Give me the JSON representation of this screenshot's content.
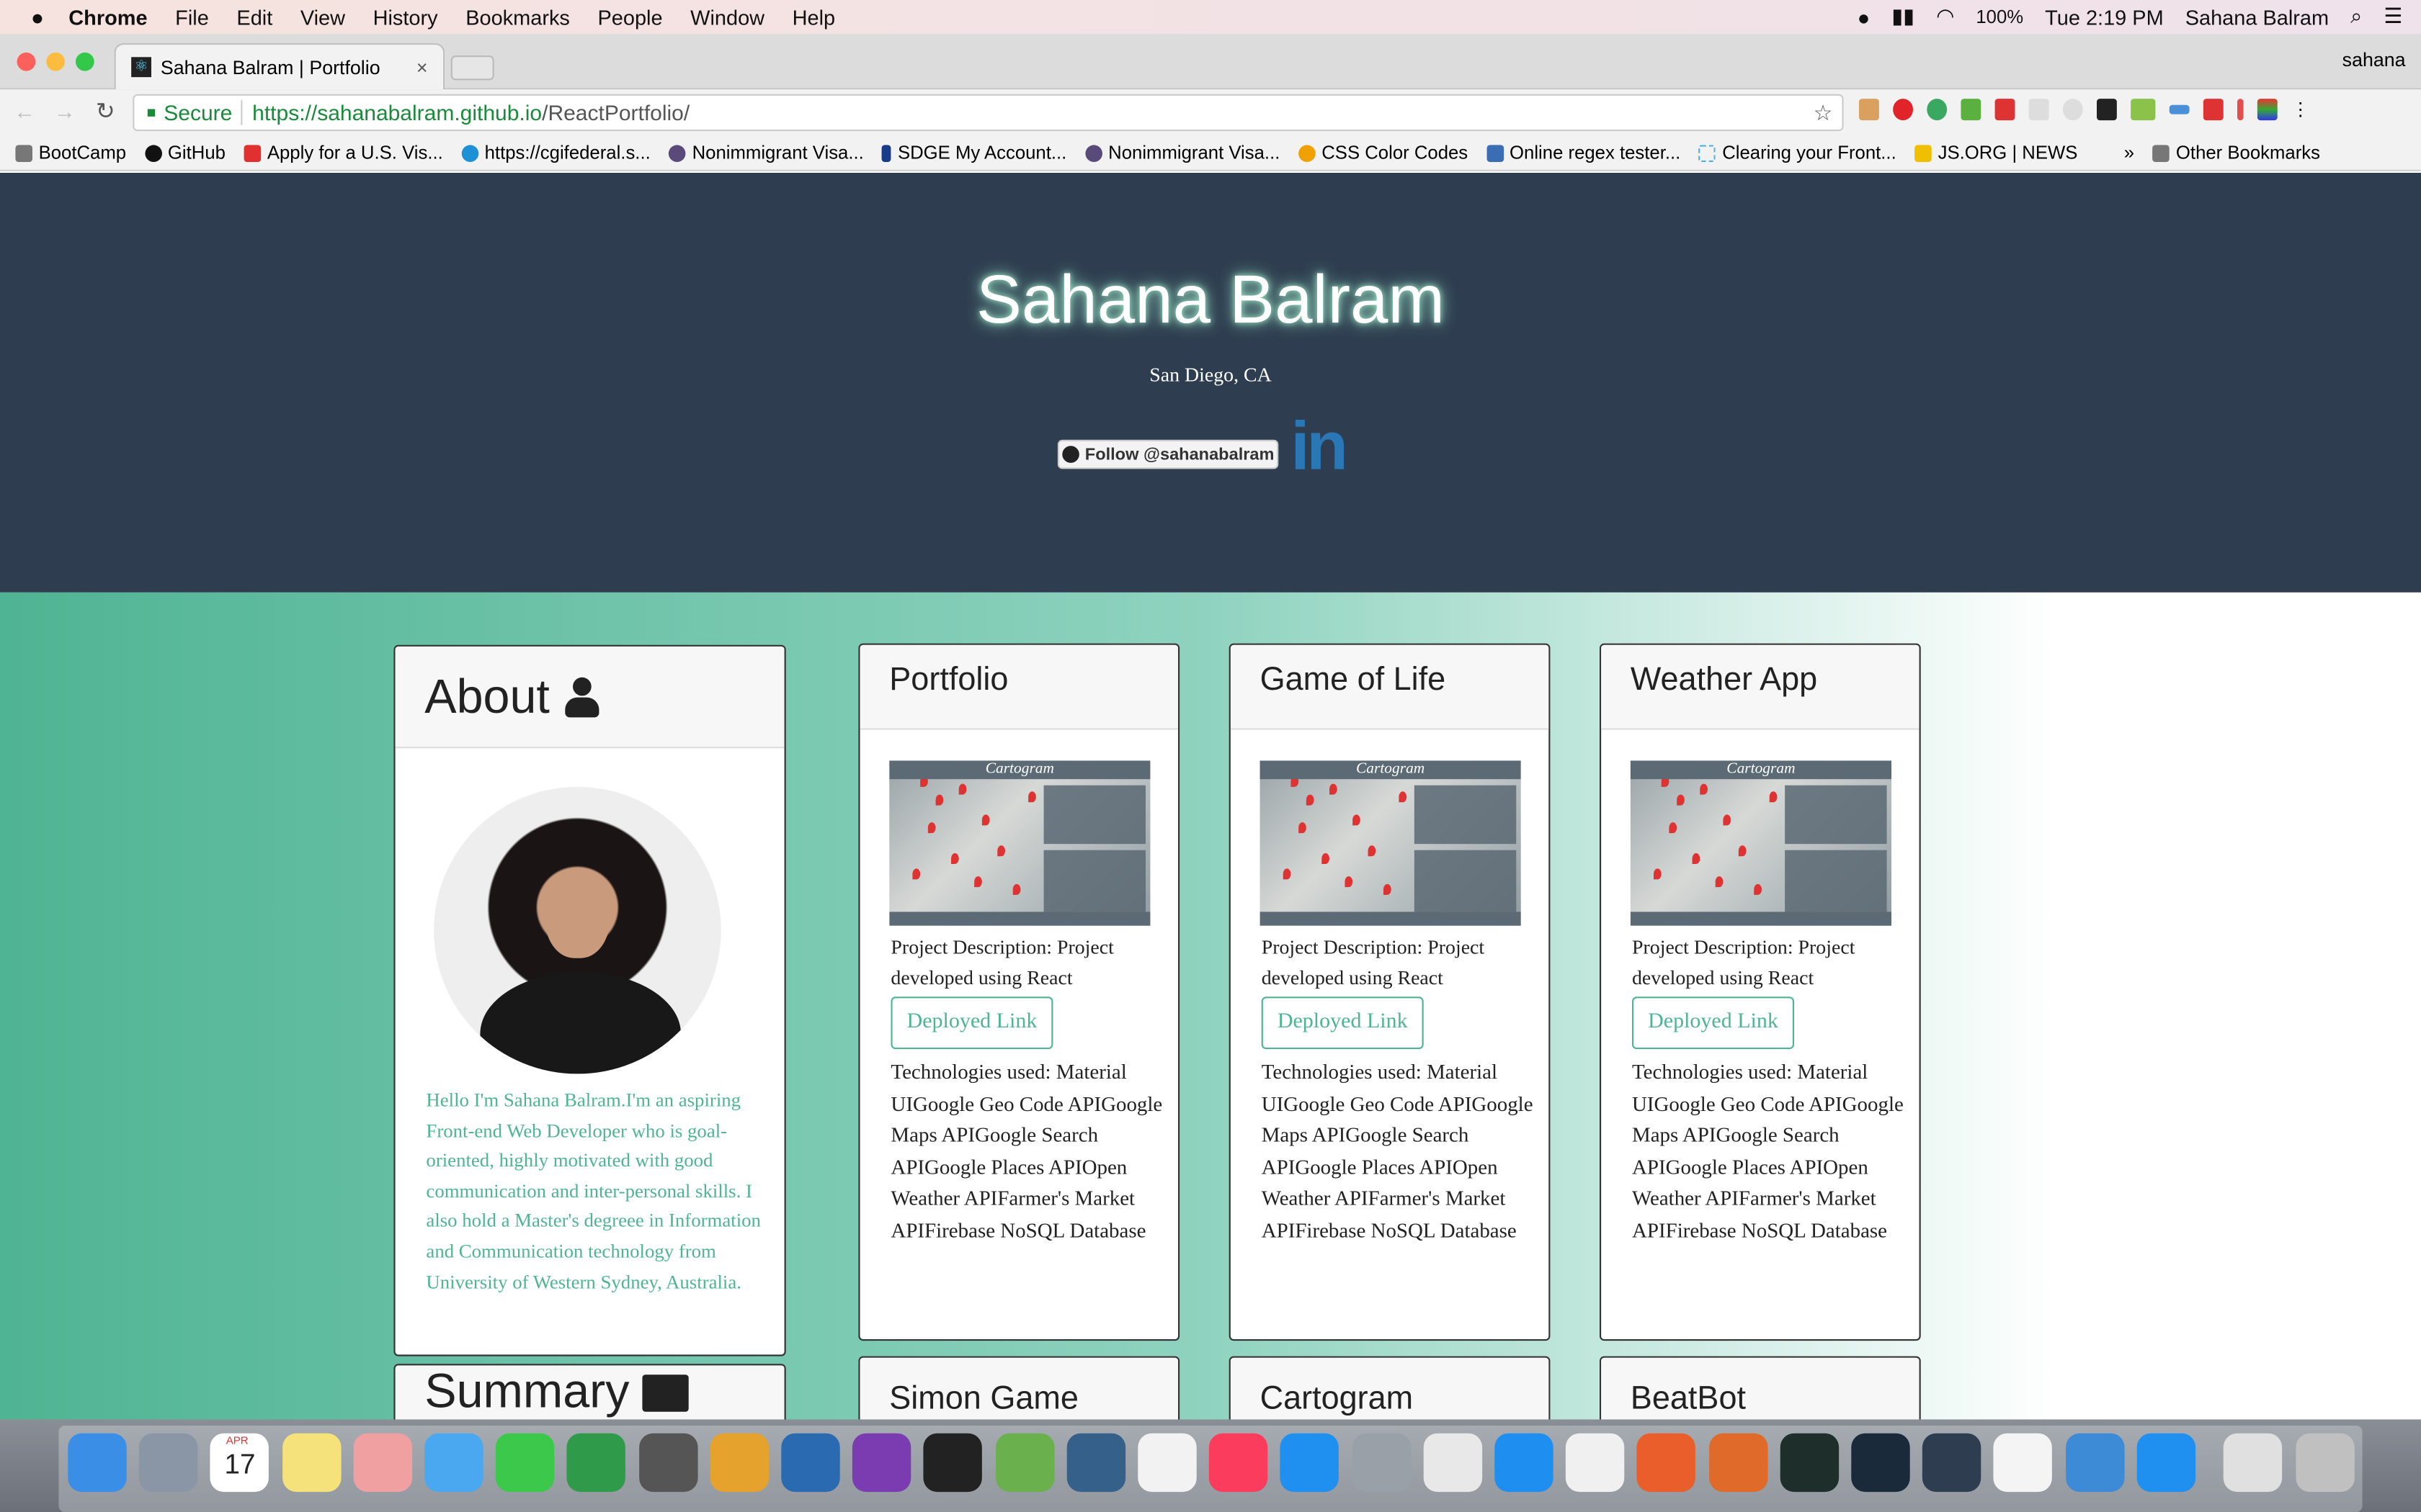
{
  "menubar": {
    "apple": "",
    "app": "Chrome",
    "items": [
      "File",
      "Edit",
      "View",
      "History",
      "Bookmarks",
      "People",
      "Window",
      "Help"
    ],
    "battery": "100%",
    "clock": "Tue 2:19 PM",
    "user": "Sahana Balram"
  },
  "browser": {
    "tab_title": "Sahana Balram | Portfolio",
    "tab_close": "×",
    "profile": "sahana",
    "secure_label": "Secure",
    "url_host": "https://sahanabalram.github.io",
    "url_path": "/ReactPortfolio/"
  },
  "bookmarks": [
    {
      "label": "BootCamp",
      "color": "#777"
    },
    {
      "label": "GitHub",
      "color": "#111"
    },
    {
      "label": "Apply for a U.S. Vis...",
      "color": "#e03030"
    },
    {
      "label": "https://cgifederal.s...",
      "color": "#1e90d6"
    },
    {
      "label": "Nonimmigrant Visa...",
      "color": "#5a4a7a"
    },
    {
      "label": "SDGE My Account...",
      "color": "#1a3a8a"
    },
    {
      "label": "Nonimmigrant Visa...",
      "color": "#5a4a7a"
    },
    {
      "label": "CSS Color Codes",
      "color": "#f0a000"
    },
    {
      "label": "Online regex tester...",
      "color": "#3b6db5"
    },
    {
      "label": "Clearing your Front...",
      "color": "#4ab0e0"
    },
    {
      "label": "JS.ORG | NEWS",
      "color": "#f0c000"
    }
  ],
  "bookmarks_more": "»",
  "other_bookmarks": "Other Bookmarks",
  "hero": {
    "name": "Sahana Balram",
    "location": "San Diego, CA",
    "follow_label": "Follow @sahanabalram",
    "linkedin": "in"
  },
  "about": {
    "title": "About",
    "bio": "Hello I'm Sahana Balram.I'm an aspiring Front-end Web Developer who is goal-oriented, highly motivated with good communication and inter-personal skills. I also hold a Master's degreee in Information and Communication technology from University of Western Sydney, Australia.",
    "color": "#4fb493"
  },
  "summary": {
    "title": "Summary"
  },
  "projects": [
    {
      "title": "Portfolio",
      "thumb_title": "Cartogram",
      "description": "Project Description: Project developed using React",
      "button": "Deployed Link",
      "technologies": "Technologies used: Material UIGoogle Geo Code APIGoogle Maps APIGoogle Search APIGoogle Places APIOpen Weather APIFarmer's Market APIFirebase NoSQL Database"
    },
    {
      "title": "Game of Life",
      "thumb_title": "Cartogram",
      "description": "Project Description: Project developed using React",
      "button": "Deployed Link",
      "technologies": "Technologies used: Material UIGoogle Geo Code APIGoogle Maps APIGoogle Search APIGoogle Places APIOpen Weather APIFarmer's Market APIFirebase NoSQL Database"
    },
    {
      "title": "Weather App",
      "thumb_title": "Cartogram",
      "description": "Project Description: Project developed using React",
      "button": "Deployed Link",
      "technologies": "Technologies used: Material UIGoogle Geo Code APIGoogle Maps APIGoogle Search APIGoogle Places APIOpen Weather APIFarmer's Market APIFirebase NoSQL Database"
    },
    {
      "title": "Simon Game"
    },
    {
      "title": "Cartogram"
    },
    {
      "title": "BeatBot"
    }
  ],
  "dock": {
    "calendar_month": "APR",
    "calendar_day": "17"
  }
}
